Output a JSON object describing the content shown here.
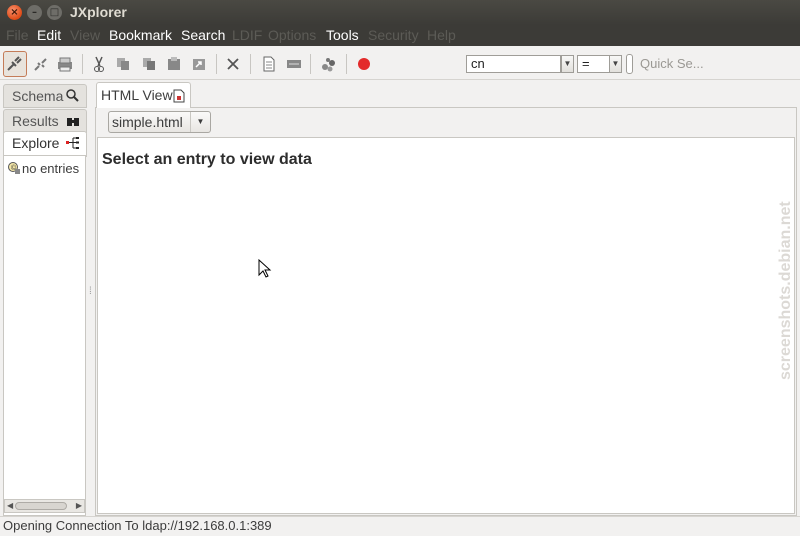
{
  "window": {
    "title": "JXplorer"
  },
  "menu": [
    {
      "label": "File",
      "enabled": false
    },
    {
      "label": "Edit",
      "enabled": true
    },
    {
      "label": "View",
      "enabled": false
    },
    {
      "label": "Bookmark",
      "enabled": true
    },
    {
      "label": "Search",
      "enabled": true
    },
    {
      "label": "LDIF",
      "enabled": false
    },
    {
      "label": "Options",
      "enabled": false
    },
    {
      "label": "Tools",
      "enabled": true
    },
    {
      "label": "Security",
      "enabled": false
    },
    {
      "label": "Help",
      "enabled": false
    }
  ],
  "toolbar": {
    "attribute_combo": "cn",
    "operator_combo": "=",
    "quick_search_placeholder": "Quick Se..."
  },
  "left_tabs": [
    {
      "label": "Schema",
      "icon": "schema-icon"
    },
    {
      "label": "Results",
      "icon": "binoculars-icon"
    },
    {
      "label": "Explore",
      "icon": "tree-icon"
    }
  ],
  "tree": {
    "item": "no entries"
  },
  "right_panel": {
    "tab_label": "HTML View",
    "template_combo": "simple.html",
    "message": "Select an entry to view data"
  },
  "watermark": "screenshots.debian.net",
  "status": "Opening Connection To ldap://192.168.0.1:389",
  "colors": {
    "titlebar": "#3c3b37",
    "close_button": "#df4a16",
    "record_button": "#e32b2b"
  }
}
